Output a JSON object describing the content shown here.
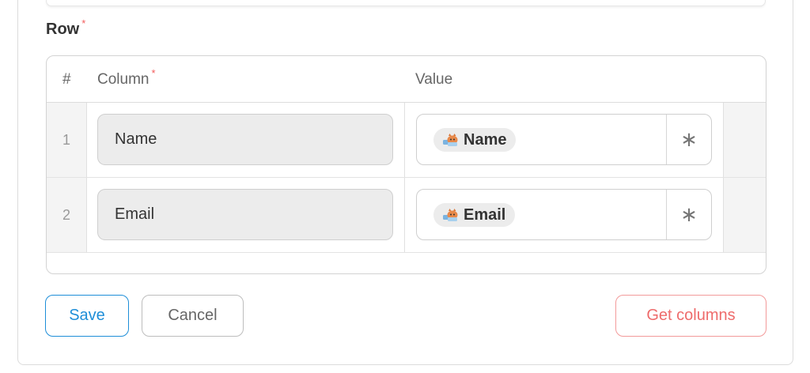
{
  "form": {
    "row_label": "Row",
    "required_mark": "*"
  },
  "table": {
    "headers": {
      "index": "#",
      "column": "Column",
      "value": "Value"
    },
    "rows": [
      {
        "index": "1",
        "column": "Name",
        "value_chip": "Name",
        "value_chip_icon": "cat-mascot-icon",
        "action_icon": "asterisk-icon",
        "action_glyph": "∗"
      },
      {
        "index": "2",
        "column": "Email",
        "value_chip": "Email",
        "value_chip_icon": "cat-mascot-icon",
        "action_icon": "asterisk-icon",
        "action_glyph": "∗"
      }
    ]
  },
  "actions": {
    "save_label": "Save",
    "cancel_label": "Cancel",
    "get_columns_label": "Get columns"
  },
  "colors": {
    "primary": "#1e8ed8",
    "danger": "#ee6b6b",
    "required": "#f25c5c"
  }
}
